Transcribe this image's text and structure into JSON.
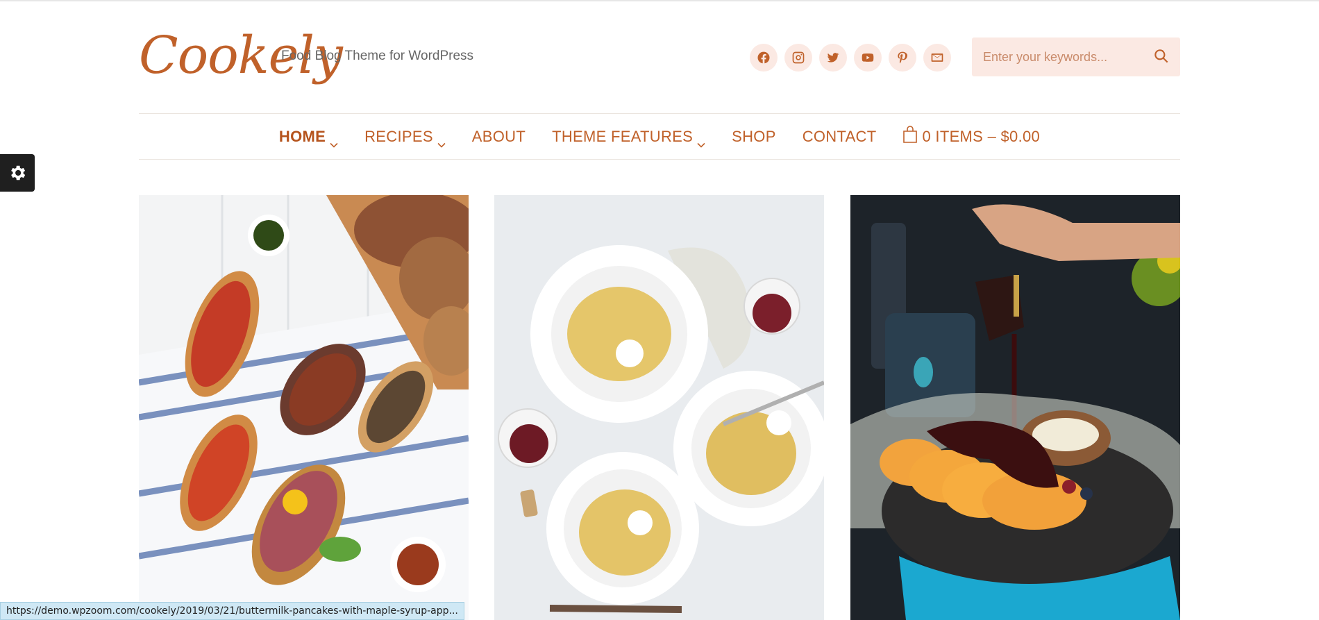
{
  "site": {
    "logo": "Cookely",
    "tagline": "Food Blog Theme for WordPress"
  },
  "socials": [
    {
      "name": "facebook-icon"
    },
    {
      "name": "instagram-icon"
    },
    {
      "name": "twitter-icon"
    },
    {
      "name": "youtube-icon"
    },
    {
      "name": "pinterest-icon"
    },
    {
      "name": "email-icon"
    }
  ],
  "search": {
    "placeholder": "Enter your keywords...",
    "icon": "search-icon"
  },
  "nav": {
    "items": [
      {
        "label": "HOME",
        "has_dropdown": true,
        "active": true
      },
      {
        "label": "RECIPES",
        "has_dropdown": true
      },
      {
        "label": "ABOUT",
        "has_dropdown": false
      },
      {
        "label": "THEME FEATURES",
        "has_dropdown": true
      },
      {
        "label": "SHOP",
        "has_dropdown": false
      },
      {
        "label": "CONTACT",
        "has_dropdown": false
      }
    ],
    "cart": {
      "label": "0 ITEMS – $0.00",
      "icon": "shopping-bag-icon"
    }
  },
  "settings": {
    "icon": "gear-icon"
  },
  "posts": [
    {
      "image": "bruschetta-appetizers-photo"
    },
    {
      "image": "spaghetti-plates-photo"
    },
    {
      "image": "pancakes-maple-syrup-photo"
    }
  ],
  "status_bar": {
    "url": "https://demo.wpzoom.com/cookely/2019/03/21/buttermilk-pancakes-with-maple-syrup-app..."
  },
  "colors": {
    "accent": "#c0612a",
    "social_bg": "#fbe9e3",
    "search_bg": "#fbe9e3"
  }
}
